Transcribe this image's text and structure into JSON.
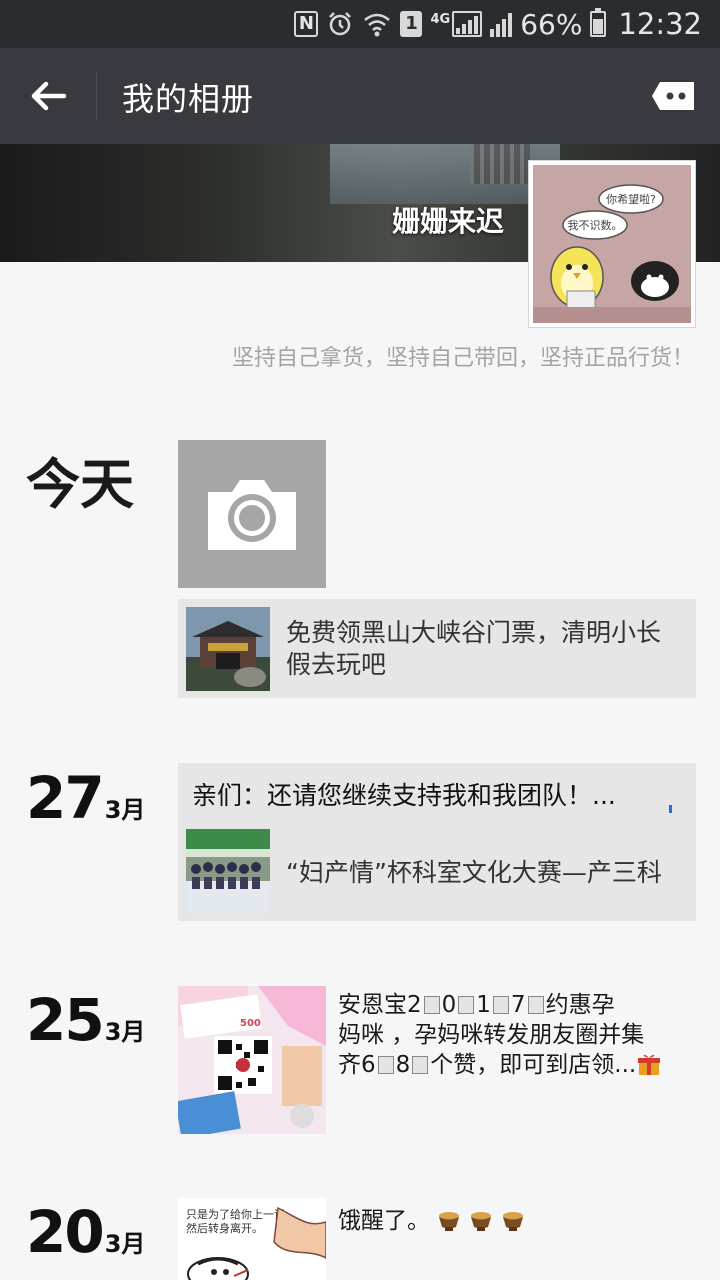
{
  "status_bar": {
    "nfc": "N",
    "sim": "1",
    "network": "4G",
    "battery": "66%",
    "time": "12:32"
  },
  "header": {
    "title": "我的相册"
  },
  "profile": {
    "nickname": "姗姗来迟",
    "signature": "坚持自己拿货，坚持自己带回，坚持正品行货！",
    "avatar_bubble_1": "你希望啦?",
    "avatar_bubble_2": "我不识数。"
  },
  "timeline": {
    "today_label": "今天",
    "today_share": "免费领黑山大峡谷门票，清明小长假去玩吧",
    "entries": [
      {
        "day": "27",
        "month": "3月",
        "text": "亲们：还请您继续支持我和我团队！...",
        "share": "“妇产情”杯科室文化大赛—产三科"
      },
      {
        "day": "25",
        "month": "3月",
        "text_line1_a": "安恩宝2",
        "text_line1_b": "0",
        "text_line1_c": "1",
        "text_line1_d": "7",
        "text_line1_e": "约惠孕",
        "text_line2": "妈咪 ，孕妈咪转发朋友圈并集",
        "text_line3_a": "齐6",
        "text_line3_b": "8",
        "text_line3_c": "个赞，即可到店领...",
        "photo_badge": "500"
      },
      {
        "day": "20",
        "month": "3月",
        "text": "饿醒了。",
        "photo_caption_1": "只是为了给你上一课，",
        "photo_caption_2": "然后转身离开。"
      }
    ]
  }
}
